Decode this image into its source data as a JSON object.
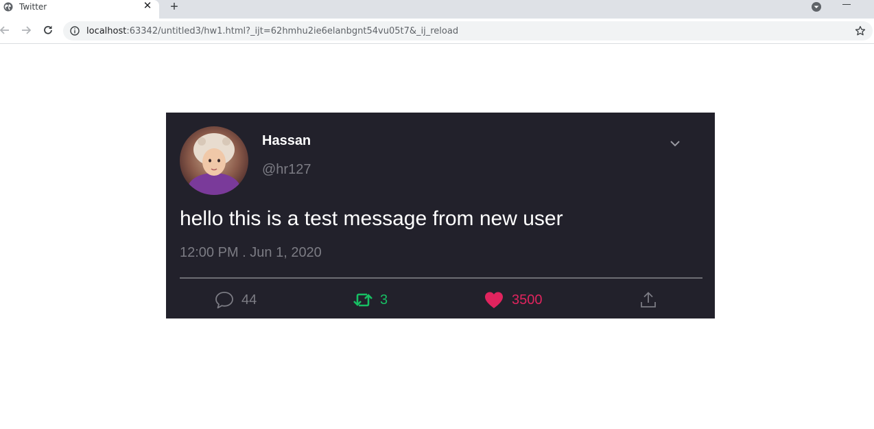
{
  "browser": {
    "tab_title": "Twitter",
    "tab_close": "✕",
    "new_tab": "+",
    "url_host": "localhost",
    "url_rest": ":63342/untitled3/hw1.html?_ijt=62hmhu2ie6elanbgnt54vu05t7&_ij_reload"
  },
  "tweet": {
    "display_name": "Hassan",
    "handle": "@hr127",
    "text": "hello this is a test message from new user",
    "timestamp": "12:00 PM . Jun 1, 2020",
    "actions": {
      "replies": "44",
      "retweets": "3",
      "likes": "3500"
    },
    "colors": {
      "card_bg": "#22212b",
      "retweet": "#17bf63",
      "like": "#e0245e",
      "muted": "#7c7c84"
    },
    "icons": {
      "reply": "speech-bubble-icon",
      "retweet": "retweet-arrows-icon",
      "like": "heart-icon",
      "share": "upload-arrow-icon",
      "menu": "chevron-down-icon"
    }
  }
}
